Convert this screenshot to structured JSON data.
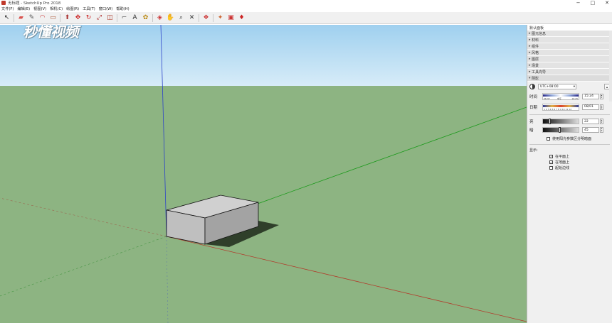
{
  "window": {
    "title": "无标题 - SketchUp Pro 2018",
    "controls": [
      "−",
      "□",
      "✕"
    ]
  },
  "menu": [
    "文件(F)",
    "编辑(E)",
    "视图(V)",
    "相机(C)",
    "绘图(R)",
    "工具(T)",
    "窗口(W)",
    "帮助(H)"
  ],
  "toolbar": {
    "icons": [
      {
        "name": "select-icon",
        "glyph": "↖",
        "color": "#222"
      },
      {
        "name": "eraser-icon",
        "glyph": "▰",
        "color": "#d9534f"
      },
      {
        "name": "pencil-icon",
        "glyph": "✎",
        "color": "#555"
      },
      {
        "name": "arc-icon",
        "glyph": "◠",
        "color": "#cc3333"
      },
      {
        "name": "rectangle-icon",
        "glyph": "▭",
        "color": "#aa5533"
      },
      {
        "name": "pushpull-icon",
        "glyph": "⬆",
        "color": "#aa3333"
      },
      {
        "name": "move-icon",
        "glyph": "✥",
        "color": "#cc2222"
      },
      {
        "name": "rotate-icon",
        "glyph": "↻",
        "color": "#cc2222"
      },
      {
        "name": "scale-icon",
        "glyph": "⤢",
        "color": "#aa2222"
      },
      {
        "name": "offset-icon",
        "glyph": "◫",
        "color": "#aa3322"
      },
      {
        "name": "tape-measure-icon",
        "glyph": "⌐",
        "color": "#666"
      },
      {
        "name": "text-icon",
        "glyph": "A",
        "color": "#333"
      },
      {
        "name": "paint-icon",
        "glyph": "✿",
        "color": "#b8860b"
      },
      {
        "name": "orbit-icon",
        "glyph": "◈",
        "color": "#cc3333"
      },
      {
        "name": "pan-icon",
        "glyph": "✋",
        "color": "#b8860b"
      },
      {
        "name": "zoom-icon",
        "glyph": "⌕",
        "color": "#333"
      },
      {
        "name": "zoom-extents-icon",
        "glyph": "✕",
        "color": "#333"
      },
      {
        "name": "warehouse-icon",
        "glyph": "❖",
        "color": "#cc3333"
      },
      {
        "name": "extension-icon",
        "glyph": "✦",
        "color": "#cc6633"
      },
      {
        "name": "share-icon",
        "glyph": "▣",
        "color": "#cc3333"
      },
      {
        "name": "ruby-icon",
        "glyph": "♦",
        "color": "#cc2222"
      }
    ]
  },
  "watermark": "秒懂视频",
  "tray": {
    "title": "默认面板",
    "panels": [
      "图元信息",
      "材料",
      "组件",
      "风格",
      "图层",
      "场景",
      "工具向导",
      "阴影"
    ],
    "shadows": {
      "timezone": "UTC+08:00",
      "time_label": "时间",
      "time_start": "06:37",
      "time_mid": "中午",
      "time_end": "19:25",
      "time_value": "15:24",
      "date_label": "日期",
      "date_months": "1 2 3 4 5 6 7 8 9 10 11 12",
      "date_value": "08/01",
      "light_label": "亮",
      "light_value": "22",
      "dark_label": "暗",
      "dark_value": "45",
      "sun_shading": "使用阳光参数区分明暗面",
      "display_label": "显示:",
      "on_faces": "在平面上",
      "on_ground": "在地面上",
      "from_edges": "起始边线"
    }
  }
}
